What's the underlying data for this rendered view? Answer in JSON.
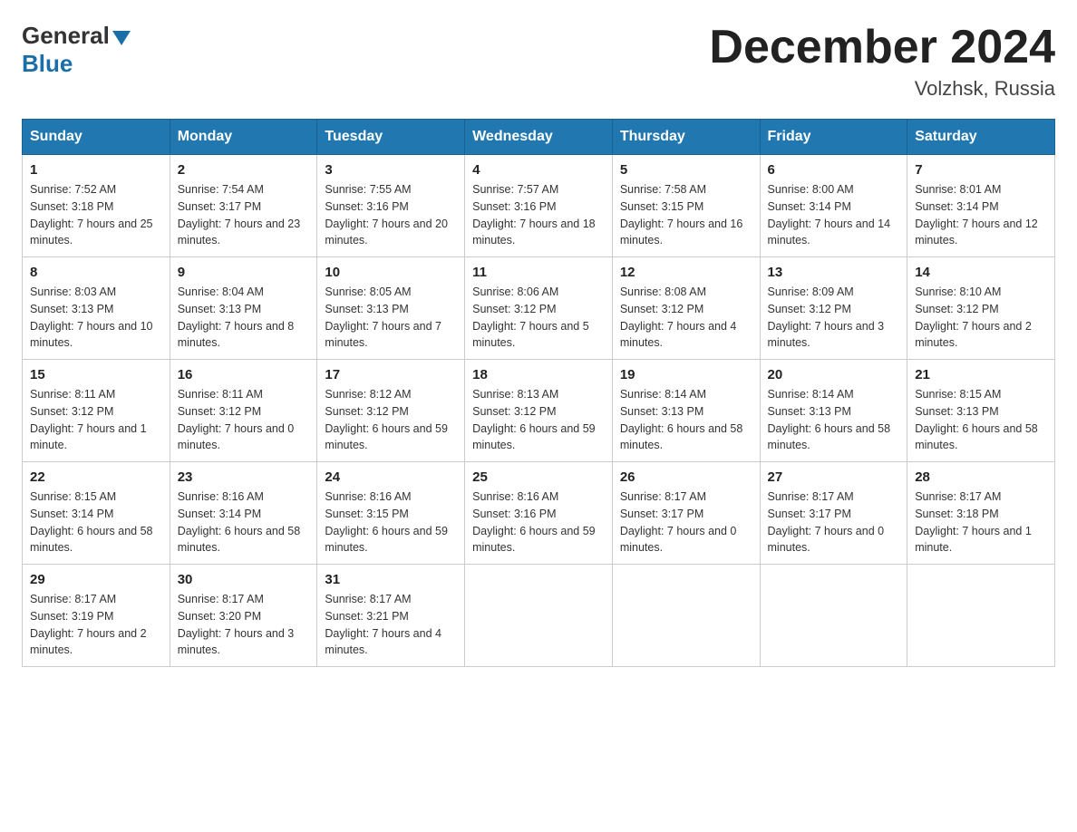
{
  "header": {
    "logo_general": "General",
    "logo_blue": "Blue",
    "title": "December 2024",
    "location": "Volzhsk, Russia"
  },
  "days_of_week": [
    "Sunday",
    "Monday",
    "Tuesday",
    "Wednesday",
    "Thursday",
    "Friday",
    "Saturday"
  ],
  "weeks": [
    [
      {
        "num": "1",
        "sunrise": "7:52 AM",
        "sunset": "3:18 PM",
        "daylight": "7 hours and 25 minutes."
      },
      {
        "num": "2",
        "sunrise": "7:54 AM",
        "sunset": "3:17 PM",
        "daylight": "7 hours and 23 minutes."
      },
      {
        "num": "3",
        "sunrise": "7:55 AM",
        "sunset": "3:16 PM",
        "daylight": "7 hours and 20 minutes."
      },
      {
        "num": "4",
        "sunrise": "7:57 AM",
        "sunset": "3:16 PM",
        "daylight": "7 hours and 18 minutes."
      },
      {
        "num": "5",
        "sunrise": "7:58 AM",
        "sunset": "3:15 PM",
        "daylight": "7 hours and 16 minutes."
      },
      {
        "num": "6",
        "sunrise": "8:00 AM",
        "sunset": "3:14 PM",
        "daylight": "7 hours and 14 minutes."
      },
      {
        "num": "7",
        "sunrise": "8:01 AM",
        "sunset": "3:14 PM",
        "daylight": "7 hours and 12 minutes."
      }
    ],
    [
      {
        "num": "8",
        "sunrise": "8:03 AM",
        "sunset": "3:13 PM",
        "daylight": "7 hours and 10 minutes."
      },
      {
        "num": "9",
        "sunrise": "8:04 AM",
        "sunset": "3:13 PM",
        "daylight": "7 hours and 8 minutes."
      },
      {
        "num": "10",
        "sunrise": "8:05 AM",
        "sunset": "3:13 PM",
        "daylight": "7 hours and 7 minutes."
      },
      {
        "num": "11",
        "sunrise": "8:06 AM",
        "sunset": "3:12 PM",
        "daylight": "7 hours and 5 minutes."
      },
      {
        "num": "12",
        "sunrise": "8:08 AM",
        "sunset": "3:12 PM",
        "daylight": "7 hours and 4 minutes."
      },
      {
        "num": "13",
        "sunrise": "8:09 AM",
        "sunset": "3:12 PM",
        "daylight": "7 hours and 3 minutes."
      },
      {
        "num": "14",
        "sunrise": "8:10 AM",
        "sunset": "3:12 PM",
        "daylight": "7 hours and 2 minutes."
      }
    ],
    [
      {
        "num": "15",
        "sunrise": "8:11 AM",
        "sunset": "3:12 PM",
        "daylight": "7 hours and 1 minute."
      },
      {
        "num": "16",
        "sunrise": "8:11 AM",
        "sunset": "3:12 PM",
        "daylight": "7 hours and 0 minutes."
      },
      {
        "num": "17",
        "sunrise": "8:12 AM",
        "sunset": "3:12 PM",
        "daylight": "6 hours and 59 minutes."
      },
      {
        "num": "18",
        "sunrise": "8:13 AM",
        "sunset": "3:12 PM",
        "daylight": "6 hours and 59 minutes."
      },
      {
        "num": "19",
        "sunrise": "8:14 AM",
        "sunset": "3:13 PM",
        "daylight": "6 hours and 58 minutes."
      },
      {
        "num": "20",
        "sunrise": "8:14 AM",
        "sunset": "3:13 PM",
        "daylight": "6 hours and 58 minutes."
      },
      {
        "num": "21",
        "sunrise": "8:15 AM",
        "sunset": "3:13 PM",
        "daylight": "6 hours and 58 minutes."
      }
    ],
    [
      {
        "num": "22",
        "sunrise": "8:15 AM",
        "sunset": "3:14 PM",
        "daylight": "6 hours and 58 minutes."
      },
      {
        "num": "23",
        "sunrise": "8:16 AM",
        "sunset": "3:14 PM",
        "daylight": "6 hours and 58 minutes."
      },
      {
        "num": "24",
        "sunrise": "8:16 AM",
        "sunset": "3:15 PM",
        "daylight": "6 hours and 59 minutes."
      },
      {
        "num": "25",
        "sunrise": "8:16 AM",
        "sunset": "3:16 PM",
        "daylight": "6 hours and 59 minutes."
      },
      {
        "num": "26",
        "sunrise": "8:17 AM",
        "sunset": "3:17 PM",
        "daylight": "7 hours and 0 minutes."
      },
      {
        "num": "27",
        "sunrise": "8:17 AM",
        "sunset": "3:17 PM",
        "daylight": "7 hours and 0 minutes."
      },
      {
        "num": "28",
        "sunrise": "8:17 AM",
        "sunset": "3:18 PM",
        "daylight": "7 hours and 1 minute."
      }
    ],
    [
      {
        "num": "29",
        "sunrise": "8:17 AM",
        "sunset": "3:19 PM",
        "daylight": "7 hours and 2 minutes."
      },
      {
        "num": "30",
        "sunrise": "8:17 AM",
        "sunset": "3:20 PM",
        "daylight": "7 hours and 3 minutes."
      },
      {
        "num": "31",
        "sunrise": "8:17 AM",
        "sunset": "3:21 PM",
        "daylight": "7 hours and 4 minutes."
      },
      null,
      null,
      null,
      null
    ]
  ]
}
